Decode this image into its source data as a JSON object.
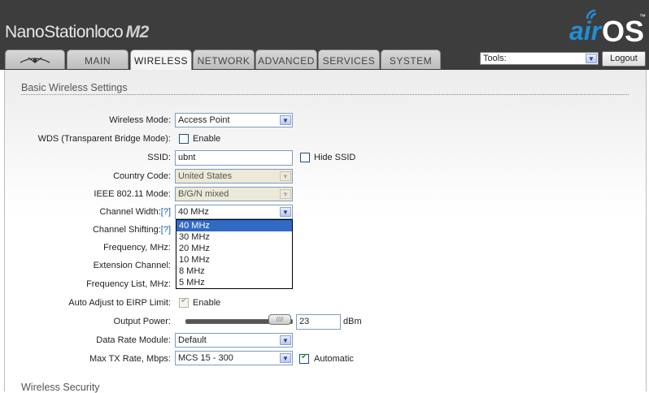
{
  "header": {
    "product": "NanoStation",
    "product_variant": "loco",
    "model": "M2",
    "logo_air": "air",
    "logo_os": "OS",
    "logo_tm": "™"
  },
  "tabs": [
    {
      "label": ""
    },
    {
      "label": "MAIN"
    },
    {
      "label": "WIRELESS"
    },
    {
      "label": "NETWORK"
    },
    {
      "label": "ADVANCED"
    },
    {
      "label": "SERVICES"
    },
    {
      "label": "SYSTEM"
    }
  ],
  "tools": {
    "selected": "Tools:"
  },
  "logout_label": "Logout",
  "sections": {
    "basic": "Basic Wireless Settings",
    "security": "Wireless Security"
  },
  "form": {
    "wireless_mode": {
      "label": "Wireless Mode:",
      "value": "Access Point"
    },
    "wds": {
      "label": "WDS (Transparent Bridge Mode):",
      "checkbox_label": "Enable",
      "checked": false
    },
    "ssid": {
      "label": "SSID:",
      "value": "ubnt",
      "hide_label": "Hide SSID",
      "hide_checked": false
    },
    "country_code": {
      "label": "Country Code:",
      "value": "United States"
    },
    "ieee_mode": {
      "label": "IEEE 802.11 Mode:",
      "value": "B/G/N mixed"
    },
    "channel_width": {
      "label": "Channel Width:",
      "help": "[?]",
      "value": "40 MHz",
      "options": [
        "40 MHz",
        "30 MHz",
        "20 MHz",
        "10 MHz",
        "8 MHz",
        "5 MHz"
      ],
      "highlighted": 0
    },
    "channel_shifting": {
      "label": "Channel Shifting:",
      "help": "[?]"
    },
    "frequency": {
      "label": "Frequency, MHz:"
    },
    "extension_channel": {
      "label": "Extension Channel:"
    },
    "frequency_list": {
      "label": "Frequency List, MHz:"
    },
    "auto_adjust": {
      "label": "Auto Adjust to EIRP Limit:",
      "checkbox_label": "Enable",
      "checked": true
    },
    "output_power": {
      "label": "Output Power:",
      "value": "23",
      "unit": "dBm",
      "level_fraction": 1.0,
      "thumb_glyph": "////"
    },
    "data_rate_module": {
      "label": "Data Rate Module:",
      "value": "Default"
    },
    "max_tx_rate": {
      "label": "Max TX Rate, Mbps:",
      "value": "MCS 15 - 300",
      "auto_label": "Automatic",
      "auto_checked": true
    }
  },
  "colors": {
    "topbar": "#3d3d3d",
    "accent": "#1f8fd6",
    "highlight": "#316ac5"
  }
}
